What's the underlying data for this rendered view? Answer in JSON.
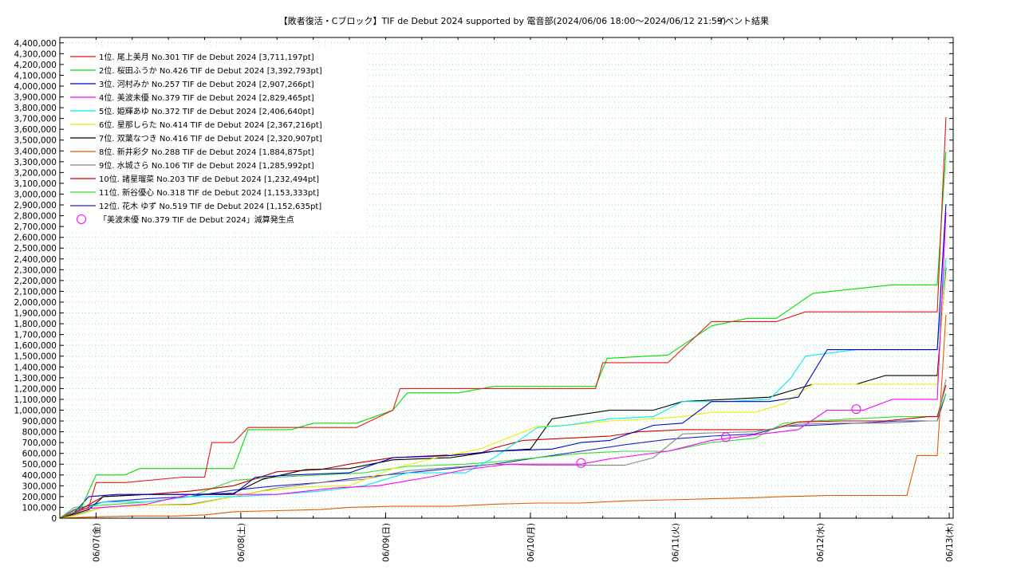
{
  "chart_data": {
    "type": "line",
    "title": "【敗者復活・Cブロック】TIF de Debut 2024 supported by 電音部(2024/06/06 18:00～2024/06/12 21:59)",
    "title_suffix": "イベント結果",
    "xlabel": "",
    "ylabel": "",
    "xlim": [
      0,
      6.17
    ],
    "ylim": [
      0,
      4450000
    ],
    "x_ticks": [
      {
        "pos": 0.25,
        "label": "06/07(金)"
      },
      {
        "pos": 1.25,
        "label": "06/08(土)"
      },
      {
        "pos": 2.25,
        "label": "06/09(日)"
      },
      {
        "pos": 3.25,
        "label": "06/10(月)"
      },
      {
        "pos": 4.25,
        "label": "06/11(火)"
      },
      {
        "pos": 5.25,
        "label": "06/12(水)"
      },
      {
        "pos": 6.25,
        "label": "06/13(木)"
      }
    ],
    "y_tick_labels": [
      "0",
      "100,000",
      "200,000",
      "300,000",
      "400,000",
      "500,000",
      "600,000",
      "700,000",
      "800,000",
      "900,000",
      "1,000,000",
      "1,100,000",
      "1,200,000",
      "1,300,000",
      "1,400,000",
      "1,500,000",
      "1,600,000",
      "1,700,000",
      "1,800,000",
      "1,900,000",
      "2,000,000",
      "2,100,000",
      "2,200,000",
      "2,300,000",
      "2,400,000",
      "2,500,000",
      "2,600,000",
      "2,700,000",
      "2,800,000",
      "2,900,000",
      "3,000,000",
      "3,100,000",
      "3,200,000",
      "3,300,000",
      "3,400,000",
      "3,500,000",
      "3,600,000",
      "3,700,000",
      "3,800,000",
      "3,900,000",
      "4,000,000",
      "4,100,000",
      "4,200,000",
      "4,300,000",
      "4,400,000"
    ],
    "grid": true,
    "legend_position": "top-left",
    "series": [
      {
        "name": "1位. 尾上美月 No.301 TIF de Debut 2024 [3,711,197pt]",
        "color": "#e41a1c",
        "x": [
          0,
          0.2,
          0.25,
          0.45,
          0.85,
          1.0,
          1.05,
          1.2,
          1.3,
          1.6,
          1.75,
          2.05,
          2.3,
          2.35,
          2.65,
          3.0,
          3.5,
          3.7,
          3.75,
          3.9,
          3.95,
          4.2,
          4.5,
          4.75,
          4.95,
          5.15,
          5.6,
          5.9,
          6.06,
          6.12
        ],
        "y": [
          0,
          100000,
          330000,
          330000,
          380000,
          380000,
          700000,
          700000,
          840000,
          840000,
          840000,
          840000,
          1000000,
          1200000,
          1200000,
          1200000,
          1200000,
          1200000,
          1440000,
          1440000,
          1440000,
          1440000,
          1820000,
          1820000,
          1820000,
          1910000,
          1910000,
          1910000,
          1910000,
          3711197
        ]
      },
      {
        "name": "2位. 桜田ふうか No.426 TIF de Debut 2024 [3,392,793pt]",
        "color": "#00dd00",
        "x": [
          0,
          0.15,
          0.25,
          0.45,
          0.55,
          0.85,
          1.2,
          1.3,
          1.6,
          1.75,
          2.05,
          2.3,
          2.4,
          2.75,
          3.0,
          3.5,
          3.7,
          3.78,
          4.2,
          4.5,
          4.75,
          4.95,
          5.2,
          5.4,
          5.75,
          5.9,
          6.06,
          6.12
        ],
        "y": [
          0,
          100000,
          400000,
          400000,
          460000,
          460000,
          460000,
          820000,
          820000,
          880000,
          880000,
          1000000,
          1160000,
          1160000,
          1220000,
          1220000,
          1220000,
          1480000,
          1510000,
          1780000,
          1850000,
          1850000,
          2080000,
          2110000,
          2160000,
          2160000,
          2160000,
          3392793
        ]
      },
      {
        "name": "3位. 河村みか No.257 TIF de Debut 2024 [2,907,266pt]",
        "color": "#0000cc",
        "x": [
          0,
          0.1,
          0.2,
          0.4,
          0.6,
          1.2,
          1.35,
          1.6,
          2.0,
          2.3,
          2.7,
          3.0,
          3.4,
          3.6,
          3.8,
          4.1,
          4.3,
          4.5,
          4.9,
          5.0,
          5.1,
          5.3,
          5.5,
          5.7,
          5.9,
          6.06,
          6.12
        ],
        "y": [
          0,
          50000,
          200000,
          220000,
          220000,
          220000,
          380000,
          400000,
          420000,
          560000,
          580000,
          620000,
          640000,
          700000,
          720000,
          860000,
          880000,
          1080000,
          1080000,
          1100000,
          1120000,
          1560000,
          1560000,
          1560000,
          1560000,
          1560000,
          2907266
        ]
      },
      {
        "name": "4位. 美波未優 No.379 TIF de Debut 2024 [2,829,465pt]",
        "color": "#ff00ff",
        "x": [
          0,
          0.1,
          0.3,
          0.6,
          0.9,
          1.2,
          1.5,
          1.9,
          2.2,
          2.55,
          2.8,
          3.1,
          3.3,
          3.6,
          3.8,
          4.2,
          4.5,
          4.85,
          5.1,
          5.3,
          5.55,
          5.75,
          6.0,
          6.06,
          6.12
        ],
        "y": [
          0,
          80000,
          100000,
          130000,
          220000,
          220000,
          220000,
          280000,
          300000,
          380000,
          450000,
          500000,
          500000,
          500000,
          550000,
          620000,
          720000,
          780000,
          820000,
          1000000,
          1000000,
          1100000,
          1100000,
          1100000,
          2829465
        ]
      },
      {
        "name": "5位. 姫輝あゆ No.372 TIF de Debut 2024 [2,406,640pt]",
        "color": "#00eeee",
        "x": [
          0,
          0.1,
          0.3,
          0.6,
          0.9,
          1.2,
          1.5,
          1.8,
          2.1,
          2.4,
          2.8,
          3.0,
          3.3,
          3.5,
          3.8,
          4.1,
          4.3,
          4.6,
          4.9,
          5.05,
          5.15,
          5.5,
          5.8,
          6.0,
          6.06,
          6.12
        ],
        "y": [
          0,
          50000,
          150000,
          150000,
          200000,
          200000,
          220000,
          250000,
          300000,
          420000,
          420000,
          560000,
          840000,
          860000,
          920000,
          940000,
          1080000,
          1080000,
          1100000,
          1300000,
          1500000,
          1560000,
          1560000,
          1560000,
          1560000,
          2406640
        ]
      },
      {
        "name": "6位. 星那しらた No.414 TIF de Debut 2024 [2,367,216pt]",
        "color": "#eeee00",
        "x": [
          0,
          0.1,
          0.3,
          0.6,
          0.9,
          1.2,
          1.4,
          1.7,
          2.0,
          2.3,
          2.6,
          2.9,
          3.3,
          3.5,
          3.8,
          4.1,
          4.3,
          4.5,
          4.8,
          5.0,
          5.2,
          5.5,
          5.8,
          6.0,
          6.06,
          6.12
        ],
        "y": [
          0,
          20000,
          100000,
          120000,
          120000,
          200000,
          250000,
          290000,
          300000,
          460000,
          560000,
          640000,
          850000,
          860000,
          900000,
          920000,
          940000,
          980000,
          980000,
          1060000,
          1240000,
          1240000,
          1240000,
          1240000,
          1240000,
          2367216
        ]
      },
      {
        "name": "7位. 双葉なつき No.416 TIF de Debut 2024 [2,320,907pt]",
        "color": "#000000",
        "x": [
          0,
          0.2,
          0.3,
          0.6,
          0.9,
          1.2,
          1.4,
          1.7,
          2.0,
          2.3,
          2.7,
          3.0,
          3.25,
          3.4,
          3.8,
          4.1,
          4.3,
          4.6,
          4.9,
          5.1,
          5.2,
          5.5,
          5.7,
          5.9,
          6.06,
          6.12
        ],
        "y": [
          0,
          80000,
          200000,
          220000,
          220000,
          230000,
          360000,
          450000,
          460000,
          540000,
          560000,
          620000,
          640000,
          920000,
          1000000,
          1000000,
          1080000,
          1100000,
          1120000,
          1200000,
          1240000,
          1240000,
          1320000,
          1320000,
          1320000,
          2320907
        ]
      },
      {
        "name": "8位. 新井彩夕 No.288 TIF de Debut 2024 [1,884,875pt]",
        "color": "#e85a00",
        "x": [
          0,
          0.2,
          0.5,
          0.8,
          1.0,
          1.2,
          1.5,
          1.8,
          2.0,
          2.3,
          2.7,
          3.0,
          3.3,
          3.6,
          3.9,
          4.2,
          4.5,
          4.8,
          5.0,
          5.3,
          5.6,
          5.85,
          5.92,
          6.0,
          6.06,
          6.12
        ],
        "y": [
          0,
          10000,
          20000,
          20000,
          30000,
          60000,
          70000,
          80000,
          100000,
          110000,
          110000,
          130000,
          140000,
          140000,
          160000,
          170000,
          180000,
          190000,
          200000,
          210000,
          210000,
          210000,
          580000,
          580000,
          580000,
          1884875
        ]
      },
      {
        "name": "9位. 水城さら No.106 TIF de Debut 2024 [1,285,992pt]",
        "color": "#888888",
        "x": [
          0,
          0.1,
          0.3,
          0.6,
          0.9,
          1.2,
          1.5,
          1.8,
          2.1,
          2.4,
          2.8,
          3.0,
          3.3,
          3.6,
          3.9,
          4.1,
          4.3,
          4.5,
          4.8,
          5.1,
          5.4,
          5.7,
          6.0,
          6.06,
          6.12
        ],
        "y": [
          0,
          30000,
          100000,
          120000,
          130000,
          200000,
          280000,
          330000,
          360000,
          440000,
          480000,
          500000,
          490000,
          490000,
          490000,
          560000,
          780000,
          790000,
          800000,
          870000,
          880000,
          880000,
          900000,
          900000,
          1285992
        ]
      },
      {
        "name": "10位. 諸星瑠菜 No.203 TIF de Debut 2024 [1,232,494pt]",
        "color": "#cc0000",
        "x": [
          0,
          0.1,
          0.3,
          0.6,
          0.9,
          1.2,
          1.5,
          1.8,
          2.0,
          2.3,
          2.6,
          2.9,
          3.0,
          3.2,
          3.5,
          3.8,
          4.0,
          4.3,
          4.6,
          4.9,
          5.1,
          5.4,
          5.7,
          6.0,
          6.06,
          6.12
        ],
        "y": [
          0,
          50000,
          200000,
          220000,
          250000,
          300000,
          430000,
          450000,
          500000,
          560000,
          580000,
          600000,
          650000,
          720000,
          740000,
          760000,
          800000,
          820000,
          820000,
          820000,
          890000,
          900000,
          900000,
          940000,
          940000,
          1232494
        ]
      },
      {
        "name": "11位. 新谷優心 No.318 TIF de Debut 2024 [1,153,333pt]",
        "color": "#33dd33",
        "x": [
          0,
          0.1,
          0.3,
          0.6,
          0.9,
          1.2,
          1.5,
          1.8,
          2.1,
          2.4,
          2.8,
          3.0,
          3.3,
          3.6,
          3.9,
          4.2,
          4.5,
          4.8,
          5.0,
          5.2,
          5.5,
          5.8,
          6.0,
          6.06,
          6.12
        ],
        "y": [
          0,
          100000,
          120000,
          150000,
          200000,
          350000,
          380000,
          400000,
          420000,
          480000,
          500000,
          520000,
          560000,
          600000,
          620000,
          620000,
          700000,
          740000,
          880000,
          900000,
          920000,
          940000,
          940000,
          940000,
          1153333
        ]
      },
      {
        "name": "12位. 花木 ゆず No.519 TIF de Debut 2024 [1,152,635pt]",
        "color": "#2222cc",
        "x": [
          0,
          0.1,
          0.3,
          0.6,
          0.9,
          1.2,
          1.5,
          1.8,
          2.1,
          2.4,
          2.7,
          3.0,
          3.3,
          3.6,
          3.9,
          4.2,
          4.5,
          4.8,
          5.0,
          5.2,
          5.5,
          5.8,
          6.0,
          6.06,
          6.12
        ],
        "y": [
          0,
          80000,
          150000,
          180000,
          200000,
          260000,
          300000,
          330000,
          380000,
          420000,
          460000,
          500000,
          560000,
          620000,
          680000,
          730000,
          760000,
          780000,
          850000,
          860000,
          880000,
          900000,
          900000,
          900000,
          1152635
        ]
      }
    ],
    "markers": {
      "name": "「美波未優 No.379 TIF de Debut 2024」減算発生点",
      "color": "#ff00ff",
      "points": [
        {
          "x": 3.6,
          "y": 510000
        },
        {
          "x": 4.6,
          "y": 750000
        },
        {
          "x": 5.5,
          "y": 1010000
        }
      ]
    }
  }
}
